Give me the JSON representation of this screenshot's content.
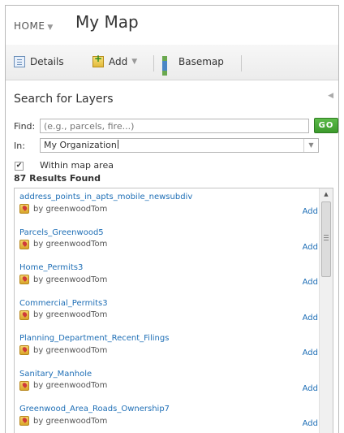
{
  "header": {
    "home_label": "HOME",
    "map_title": "My Map"
  },
  "toolbar": {
    "details_label": "Details",
    "add_label": "Add",
    "basemap_label": "Basemap"
  },
  "search": {
    "title": "Search for Layers",
    "find_label": "Find:",
    "find_placeholder": "(e.g., parcels, fire...)",
    "go_label": "GO",
    "in_label": "In:",
    "in_value": "My Organization",
    "within_label": "Within map area",
    "within_checked": true,
    "results_count": "87 Results Found"
  },
  "results": [
    {
      "name": "address_points_in_apts_mobile_newsubdiv",
      "owner": "by greenwoodTom",
      "action": "Add"
    },
    {
      "name": "Parcels_Greenwood5",
      "owner": "by greenwoodTom",
      "action": "Add"
    },
    {
      "name": "Home_Permits3",
      "owner": "by greenwoodTom",
      "action": "Add"
    },
    {
      "name": "Commercial_Permits3",
      "owner": "by greenwoodTom",
      "action": "Add"
    },
    {
      "name": "Planning_Department_Recent_Filings",
      "owner": "by greenwoodTom",
      "action": "Add"
    },
    {
      "name": "Sanitary_Manhole",
      "owner": "by greenwoodTom",
      "action": "Add"
    },
    {
      "name": "Greenwood_Area_Roads_Ownership7",
      "owner": "by greenwoodTom",
      "action": "Add"
    }
  ],
  "colors": {
    "link": "#1f6fb6",
    "go_button": "#4aa83a",
    "layer_icon": "#e2b93b"
  },
  "icons": {
    "details": "details-icon",
    "add": "add-layer-icon",
    "basemap": "basemap-grid-icon",
    "layer": "feature-layer-icon"
  }
}
